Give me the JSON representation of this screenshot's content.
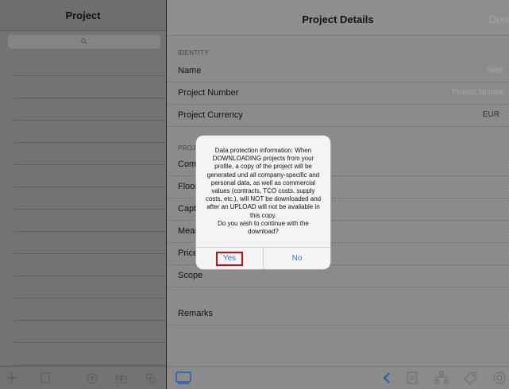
{
  "left": {
    "title": "Project",
    "search_icon": "search-icon",
    "toolbar": [
      "plus-icon",
      "copy-icon",
      "cloud-upload-icon",
      "download-icon",
      "settings-icon"
    ]
  },
  "right": {
    "title": "Project Details",
    "done_label": "Done",
    "sections": {
      "identity": "IDENTITY",
      "project": "PROJ"
    },
    "rows": {
      "name": {
        "label": "Name",
        "value": "Nam"
      },
      "project_number": {
        "label": "Project Number",
        "value": "Project Numbe"
      },
      "currency": {
        "label": "Project Currency",
        "value": "EUR"
      },
      "com": {
        "label": "Com"
      },
      "floor": {
        "label": "Floor"
      },
      "capt": {
        "label": "Capt"
      },
      "meas": {
        "label": "Meas"
      },
      "price": {
        "label": "Price"
      },
      "scope": {
        "label": "Scope"
      },
      "remarks": {
        "label": "Remarks"
      }
    },
    "toolbar": [
      "tablet-icon",
      "back-chevron-icon",
      "document-icon",
      "hierarchy-icon",
      "tag-icon",
      "gear-icon"
    ]
  },
  "alert": {
    "message": "Data protection information: When DOWNLOADING projects from your profile, a copy of the project will be generated und all company-specific and personal data, as well as commercial values (contracts, TCO costs, supply costs, etc.), will NOT be downloaded and after an UPLOAD will not be available in this copy.\nDo you wish to continue with the download?",
    "yes": "Yes",
    "no": "No"
  },
  "colors": {
    "accent": "#1a7cf5",
    "highlight": "#d10b0b"
  }
}
